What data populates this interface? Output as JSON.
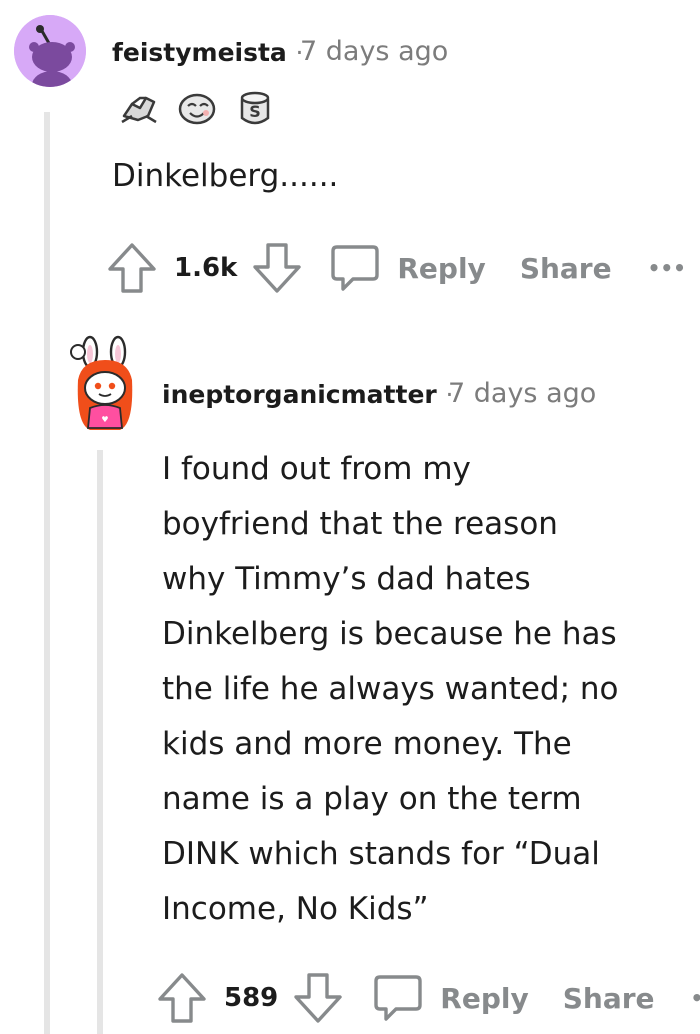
{
  "comments": [
    {
      "username": "feistymeista",
      "separator": "·",
      "timestamp": "7 days ago",
      "awards": [
        "arm-wrestle-award-icon",
        "smiling-face-award-icon",
        "silver-coin-award-icon"
      ],
      "body": "Dinkelberg......",
      "votes": "1.6k",
      "reply_label": "Reply",
      "share_label": "Share",
      "more_label": "•••",
      "avatar_color": "#d7a9f7"
    },
    {
      "username": "ineptorganicmatter",
      "separator": "·",
      "timestamp": "7 days ago",
      "body_lines": [
        "I found out from my",
        "boyfriend that the reason",
        "why Timmy’s dad hates",
        "Dinkelberg is because he has",
        "the life he always wanted; no",
        "kids and more money. The",
        "name is a play on the term",
        "DINK which stands for “Dual",
        "Income, No Kids”"
      ],
      "votes": "589",
      "reply_label": "Reply",
      "share_label": "Share",
      "more_label": "•",
      "avatar_colors": {
        "hair": "#f04e1a",
        "shirt": "#ff4fa0",
        "ears": "#ffffff"
      }
    }
  ],
  "colors": {
    "text": "#1c1c1c",
    "meta": "#7c7c7c",
    "action": "#878a8c",
    "thread_line": "#e5e5e5"
  }
}
